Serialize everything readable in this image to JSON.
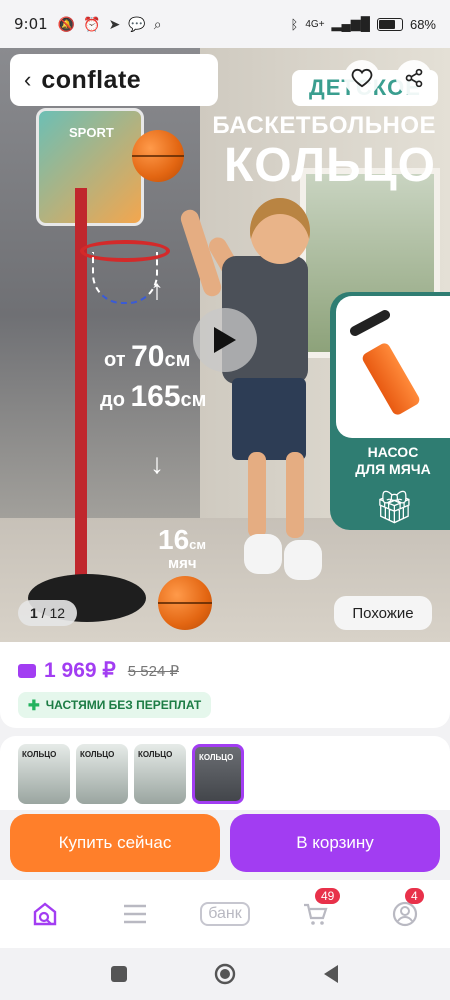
{
  "status_bar": {
    "time": "9:01",
    "network": "4G+",
    "battery": "68%",
    "battery_level": 0.68
  },
  "header": {
    "logo": "conflate",
    "back_icon": "back-chevron-icon",
    "favorite_icon": "heart-icon",
    "share_icon": "share-icon"
  },
  "hero": {
    "tag": "ДЕТСКОЕ",
    "headline_line1": "БАСКЕТБОЛЬНОЕ",
    "headline_line2": "КОЛЬЦО",
    "board_text": "SPORT",
    "height_from_prefix": "от",
    "height_from_value": "70",
    "height_from_unit": "см",
    "height_to_prefix": "до",
    "height_to_value": "165",
    "height_to_unit": "см",
    "ball_size_value": "16",
    "ball_size_unit": "см",
    "ball_size_label": "мяч",
    "pump_label_line1": "НАСОС",
    "pump_label_line2": "ДЛЯ МЯЧА",
    "image_index": "1",
    "image_total": "12",
    "similar_label": "Похожие"
  },
  "price": {
    "current": "1 969 ₽",
    "old": "5 524 ₽",
    "installments": "ЧАСТЯМИ БЕЗ ПЕРЕПЛАТ"
  },
  "thumbnails": [
    {
      "title": "КОЛЬЦО"
    },
    {
      "title": "КОЛЬЦО"
    },
    {
      "title": "КОЛЬЦО"
    },
    {
      "title": "КОЛЬЦО"
    }
  ],
  "actions": {
    "buy_now": "Купить сейчас",
    "add_to_cart": "В корзину"
  },
  "bottom_nav": {
    "bank_label": "банк",
    "cart_badge": "49",
    "profile_badge": "4"
  },
  "colors": {
    "accent": "#a23df2",
    "buy_now": "#ff7f2a",
    "installments_text": "#1c7c44",
    "tag_text": "#3a9e8f",
    "badge": "#e8314a"
  }
}
